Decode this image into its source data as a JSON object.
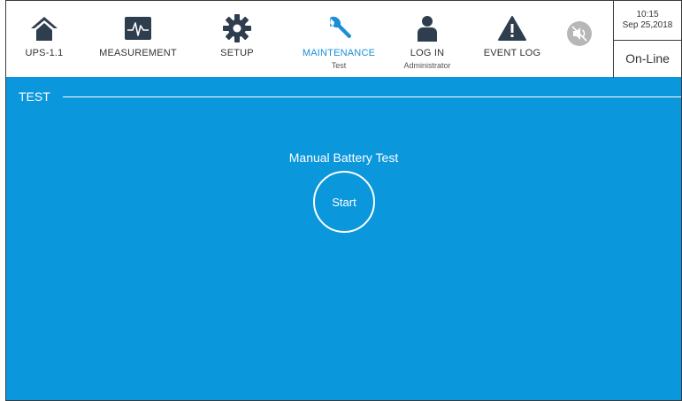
{
  "nav": {
    "ups": {
      "label": "UPS-1.1",
      "icon": "home-icon"
    },
    "measurement": {
      "label": "MEASUREMENT",
      "icon": "waveform-icon"
    },
    "setup": {
      "label": "SETUP",
      "icon": "gear-icon"
    },
    "maintenance": {
      "label": "MAINTENANCE",
      "sublabel": "Test",
      "icon": "wrench-icon"
    },
    "login": {
      "label": "LOG IN",
      "sublabel": "Administrator",
      "icon": "user-icon"
    },
    "eventlog": {
      "label": "EVENT LOG",
      "icon": "warning-icon"
    },
    "mute": {
      "icon": "speaker-muted-icon"
    }
  },
  "clock": {
    "time": "10:15",
    "date": "Sep 25,2018"
  },
  "status": "On-Line",
  "section": {
    "title": "TEST"
  },
  "test": {
    "title": "Manual Battery Test",
    "start_label": "Start"
  },
  "colors": {
    "accent": "#1a8fd8",
    "panel": "#0a97dc",
    "icon_dark": "#2f3e4e"
  }
}
